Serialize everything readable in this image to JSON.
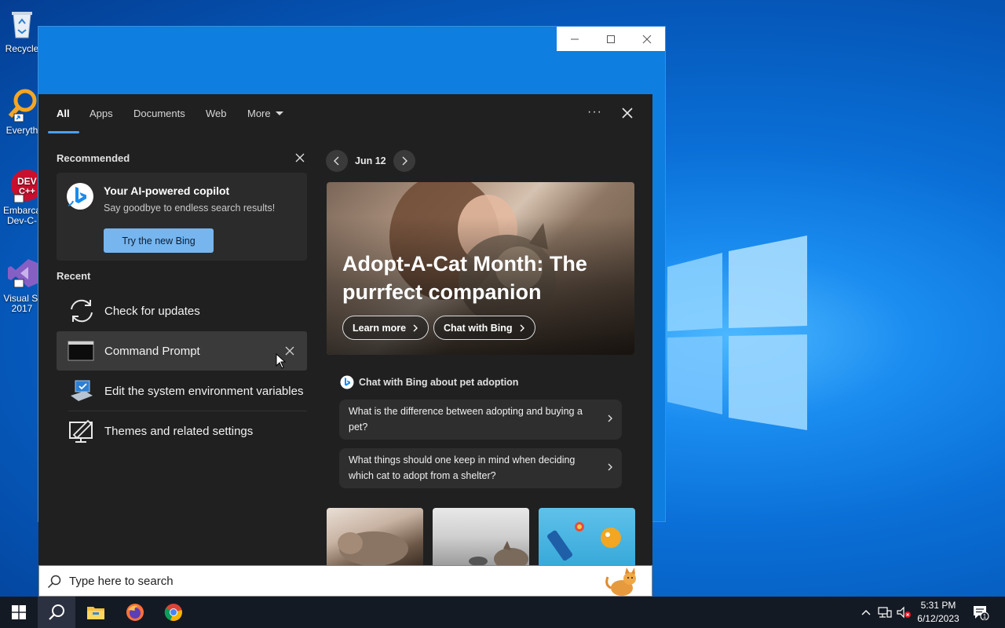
{
  "desktop": {
    "icons": [
      {
        "label": "Recycle",
        "icon": "recycle-bin-icon"
      },
      {
        "label": "Everyth",
        "icon": "everything-search-icon"
      },
      {
        "label": "Embarca",
        "label2": "Dev-C-",
        "icon": "devcpp-icon"
      },
      {
        "label": "Visual St",
        "label2": "2017",
        "icon": "visual-studio-icon"
      }
    ]
  },
  "tabs": [
    {
      "label": "All"
    },
    {
      "label": "Apps"
    },
    {
      "label": "Documents"
    },
    {
      "label": "Web"
    },
    {
      "label": "More"
    }
  ],
  "recommended": {
    "title": "Recommended",
    "card_title": "Your AI-powered copilot",
    "card_subtitle": "Say goodbye to endless search results!",
    "button_label": "Try the new Bing"
  },
  "recent": {
    "title": "Recent",
    "items": [
      {
        "label": "Check for updates",
        "icon": "refresh-icon"
      },
      {
        "label": "Command Prompt",
        "icon": "command-prompt-icon"
      },
      {
        "label": "Edit the system environment variables",
        "icon": "system-properties-icon"
      },
      {
        "label": "Themes and related settings",
        "icon": "themes-icon"
      }
    ]
  },
  "highlights": {
    "date": "Jun 12",
    "hero_title": "Adopt-A-Cat Month: The purrfect companion",
    "learn_more": "Learn more",
    "chat_with_bing": "Chat with Bing",
    "chat_heading": "Chat with Bing about pet adoption",
    "suggestions": [
      "What is the difference between adopting and buying a pet?",
      "What things should one keep in mind when deciding which cat to adopt from a shelter?"
    ]
  },
  "search": {
    "placeholder": "Type here to search"
  },
  "taskbar": {
    "time": "5:31 PM",
    "date": "6/12/2023",
    "notification_count": "1"
  },
  "colors": {
    "accent": "#4aa0f0",
    "flyout_bg": "#202020",
    "bing_button": "#77b5ee"
  }
}
